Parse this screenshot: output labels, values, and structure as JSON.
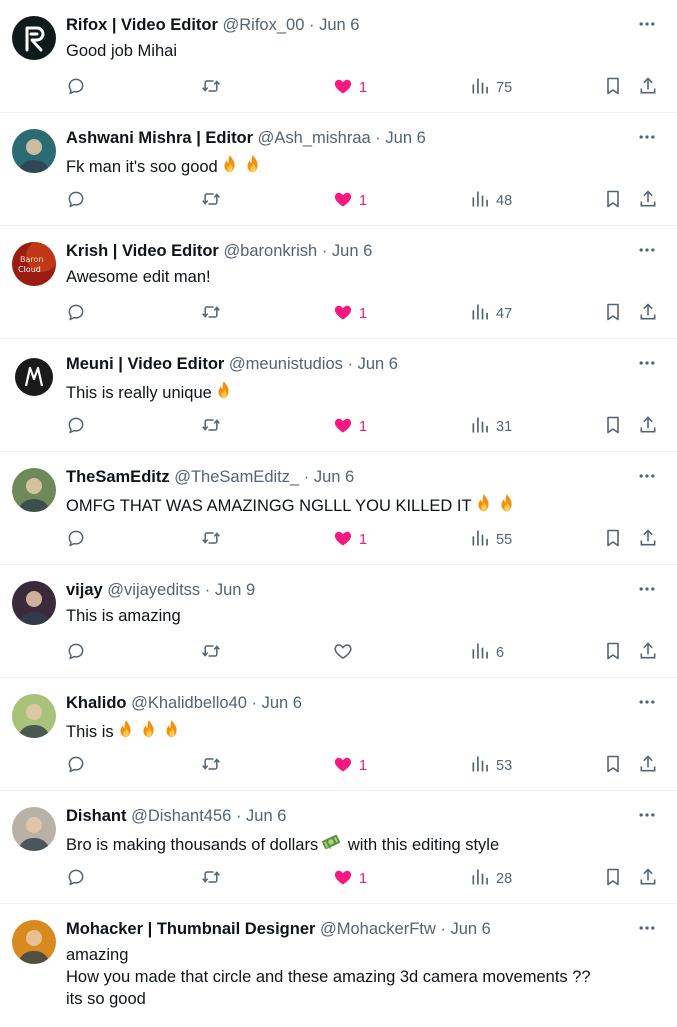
{
  "replies": [
    {
      "name": "Rifox | Video Editor",
      "handle": "@Rifox_00",
      "dot": "·",
      "date": "Jun 6",
      "text": "Good job Mihai",
      "emoji": [],
      "liked": true,
      "likes": "1",
      "views": "75",
      "avatar": {
        "bg": "#0f1a1c",
        "mark": "R"
      }
    },
    {
      "name": "Ashwani Mishra | Editor",
      "handle": "@Ash_mishraa",
      "dot": "·",
      "date": "Jun 6",
      "text": "Fk man it's soo good",
      "emoji": [
        "fire-icon",
        "fire-icon"
      ],
      "liked": true,
      "likes": "1",
      "views": "48",
      "avatar": {
        "bg": "#2a6b74"
      }
    },
    {
      "name": "Krish | Video Editor",
      "handle": "@baronkrish",
      "dot": "·",
      "date": "Jun 6",
      "text": "Awesome edit man!",
      "emoji": [],
      "liked": true,
      "likes": "1",
      "views": "47",
      "avatar": {
        "bg": "#9b1c10",
        "line1": "Baron",
        "line2": "Cloud"
      }
    },
    {
      "name": "Meuni | Video Editor",
      "handle": "@meunistudios",
      "dot": "·",
      "date": "Jun 6",
      "text": "This is really unique",
      "emoji": [
        "fire-icon"
      ],
      "liked": true,
      "likes": "1",
      "views": "31",
      "avatar": {
        "bg": "#1a1a1a",
        "mark": "M"
      }
    },
    {
      "name": "TheSamEditz",
      "handle": "@TheSamEditz_",
      "dot": "·",
      "date": "Jun 6",
      "text": "OMFG THAT WAS AMAZINGG NGLLL YOU KILLED IT",
      "emoji": [
        "fire-icon",
        "fire-icon"
      ],
      "liked": true,
      "likes": "1",
      "views": "55",
      "avatar": {
        "bg": "#6f8a5a"
      }
    },
    {
      "name": "vijay",
      "handle": "@vijayeditss",
      "dot": "·",
      "date": "Jun 9",
      "text": "This is amazing",
      "emoji": [],
      "liked": false,
      "likes": "",
      "views": "6",
      "avatar": {
        "bg": "#3a2a3c"
      }
    },
    {
      "name": "Khalido",
      "handle": "@Khalidbello40",
      "dot": "·",
      "date": "Jun 6",
      "text": "This is",
      "emoji": [
        "fire-icon",
        "fire-icon",
        "fire-icon"
      ],
      "liked": true,
      "likes": "1",
      "views": "53",
      "avatar": {
        "bg": "#a8c27a"
      }
    },
    {
      "name": "Dishant",
      "handle": "@Dishant456",
      "dot": "·",
      "date": "Jun 6",
      "text": "Bro is making thousands of dollars",
      "text2": "with this editing style",
      "emoji": [
        "money-icon"
      ],
      "liked": true,
      "likes": "1",
      "views": "28",
      "avatar": {
        "bg": "#b9b1a6"
      }
    },
    {
      "name": "Mohacker | Thumbnail Designer",
      "handle": "@MohackerFtw",
      "dot": "·",
      "date": "Jun 6",
      "text": "amazing\nHow you made that circle and these amazing 3d camera movements ??\nits so good",
      "emoji": [],
      "liked": null,
      "likes": "",
      "views": "",
      "avatar": {
        "bg": "#d98a1f"
      }
    }
  ],
  "colors": {
    "muted": "#536471",
    "like": "#f91880",
    "divider": "#eff3f4"
  }
}
